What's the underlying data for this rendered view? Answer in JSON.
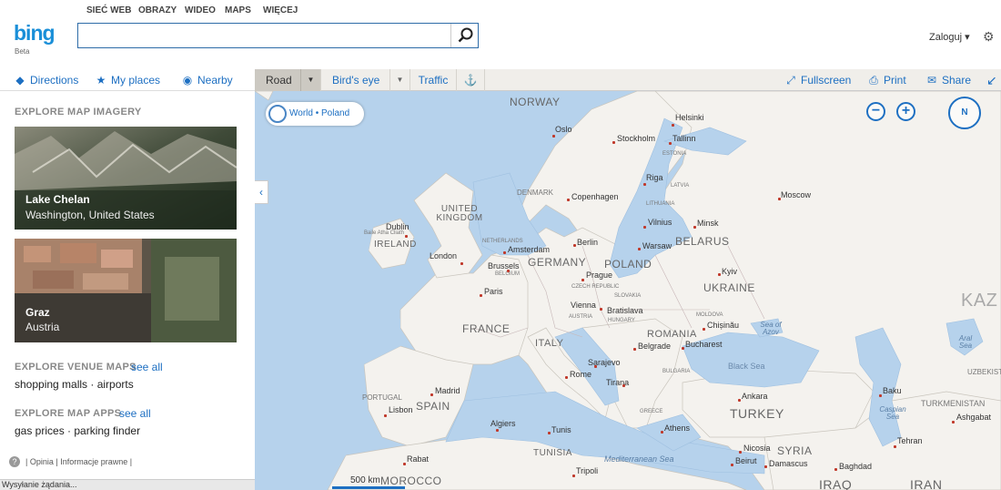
{
  "topnav": [
    "SIEĆ WEB",
    "OBRAZY",
    "WIDEO",
    "MAPS",
    "WIĘCEJ"
  ],
  "logo": {
    "text": "bing",
    "badge": "Beta"
  },
  "search": {
    "value": "",
    "placeholder": ""
  },
  "account": {
    "login": "Zaloguj ▾"
  },
  "toolbar": {
    "directions": "Directions",
    "myplaces": "My places",
    "nearby": "Nearby",
    "road": "Road",
    "birdseye": "Bird's eye",
    "traffic": "Traffic",
    "fullscreen": "Fullscreen",
    "print": "Print",
    "share": "Share"
  },
  "sidebar": {
    "imagery_title": "EXPLORE MAP IMAGERY",
    "thumbs": [
      {
        "title": "Lake Chelan",
        "subtitle": "Washington, United States"
      },
      {
        "title": "Graz",
        "subtitle": "Austria"
      }
    ],
    "venue_title": "EXPLORE VENUE MAPS",
    "venue_see_all": "see all",
    "venue_links": "shopping malls · airports",
    "apps_title": "EXPLORE MAP APPS",
    "apps_see_all": "see all",
    "apps_links": "gas prices · parking finder",
    "footer": "|  Opinia  |  Informacje prawne  |",
    "status": "Wysyłanie żądania..."
  },
  "map": {
    "breadcrumb": "World • Poland",
    "scale": "500 km",
    "compass": "N",
    "zoom_out": "−",
    "zoom_in": "+",
    "countries": [
      "NORWAY",
      "UNITED KINGDOM",
      "IRELAND",
      "FRANCE",
      "SPAIN",
      "PORTUGAL",
      "GERMANY",
      "POLAND",
      "UKRAINE",
      "BELARUS",
      "ITALY",
      "ROMANIA",
      "TURKEY",
      "SYRIA",
      "TUNISIA",
      "MOROCCO",
      "IRAQ",
      "IRAN",
      "KAZ",
      "LATVIA",
      "ESTONIA",
      "LITHUANIA",
      "DENMARK",
      "NETHERLANDS",
      "BELGIUM",
      "CZECH REPUBLIC",
      "SLOVAKIA",
      "AUSTRIA",
      "HUNGARY",
      "MOLDOVA",
      "BULGARIA",
      "GREECE",
      "UZBEKIST",
      "TURKMENISTAN"
    ],
    "cities": [
      "Oslo",
      "Stockholm",
      "Helsinki",
      "Tallinn",
      "Riga",
      "Copenhagen",
      "Vilnius",
      "Minsk",
      "Moscow",
      "Dublin",
      "London",
      "Amsterdam",
      "Berlin",
      "Warsaw",
      "Brussels",
      "Paris",
      "Prague",
      "Kyiv",
      "Vienna",
      "Bratislava",
      "Chișinău",
      "Belgrade",
      "Bucharest",
      "Sarajevo",
      "Rome",
      "Tirana",
      "Madrid",
      "Lisbon",
      "Algiers",
      "Tunis",
      "Athens",
      "Ankara",
      "Baku",
      "Ashgabat",
      "Tehran",
      "Nicosia",
      "Beirut",
      "Damascus",
      "Baghdad",
      "Rabat",
      "Tripoli",
      "Baile Atha Cliath"
    ],
    "seas": [
      "Black Sea",
      "Caspian Sea",
      "Sea of Azov",
      "Mediterranean Sea",
      "Aral Sea"
    ]
  },
  "colors": {
    "accent": "#1d6fc2",
    "water": "#b6d2ec",
    "land": "#f4f2ee",
    "logo": "#1a8fd8"
  }
}
